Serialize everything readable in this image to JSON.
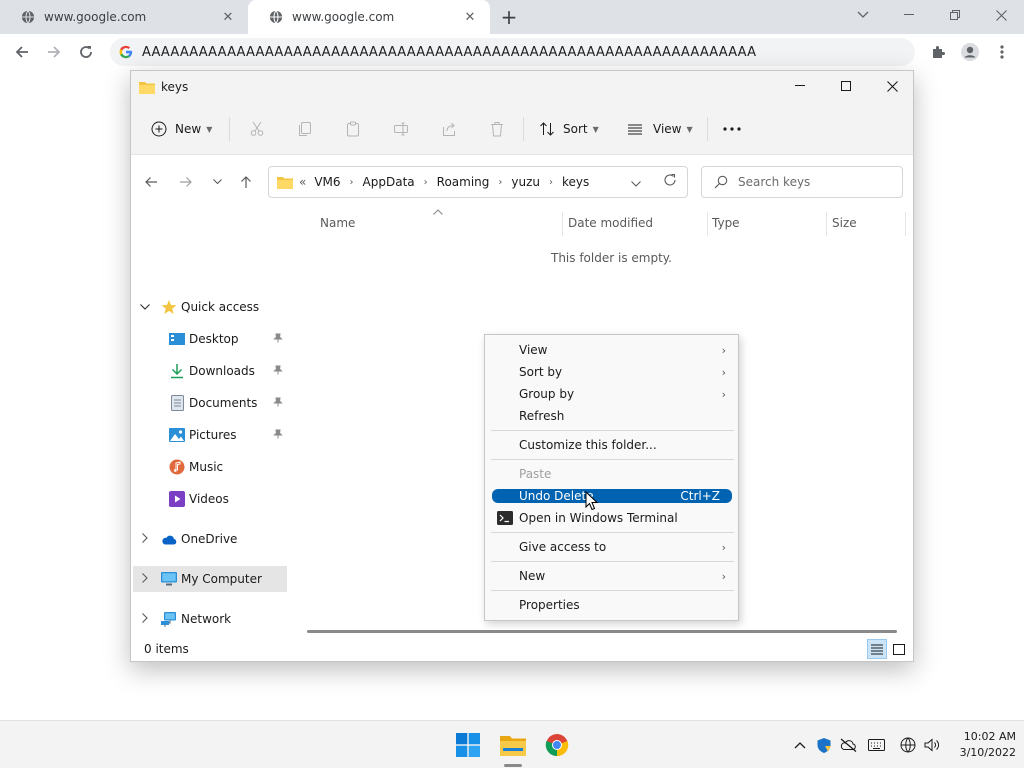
{
  "browser": {
    "tabs": [
      {
        "label": "www.google.com"
      },
      {
        "label": "www.google.com"
      }
    ],
    "url": "AAAAAAAAAAAAAAAAAAAAAAAAAAAAAAAAAAAAAAAAAAAAAAAAAAAAAAAAAAAAAAAAA"
  },
  "explorer": {
    "title": "keys",
    "commands": {
      "new_label": "New",
      "sort_label": "Sort",
      "view_label": "View"
    },
    "breadcrumb": [
      "VM6",
      "AppData",
      "Roaming",
      "yuzu",
      "keys"
    ],
    "breadcrumb_overflow": "«",
    "search_placeholder": "Search keys",
    "nav": {
      "quick_access": "Quick access",
      "desktop": "Desktop",
      "downloads": "Downloads",
      "documents": "Documents",
      "pictures": "Pictures",
      "music": "Music",
      "videos": "Videos",
      "onedrive": "OneDrive",
      "my_computer": "My Computer",
      "network": "Network"
    },
    "columns": {
      "name": "Name",
      "date_modified": "Date modified",
      "type": "Type",
      "size": "Size"
    },
    "empty_message": "This folder is empty.",
    "status": {
      "item_count": "0 items"
    }
  },
  "context_menu": {
    "view": "View",
    "sort_by": "Sort by",
    "group_by": "Group by",
    "refresh": "Refresh",
    "customize": "Customize this folder...",
    "paste": "Paste",
    "undo_delete": "Undo Delete",
    "undo_shortcut": "Ctrl+Z",
    "open_terminal": "Open in Windows Terminal",
    "give_access": "Give access to",
    "new": "New",
    "properties": "Properties"
  },
  "taskbar": {
    "time": "10:02 AM",
    "date": "3/10/2022"
  },
  "colors": {
    "accent": "#0063b1",
    "folder": "#f4c542",
    "taskbar": "#f3f3f3"
  }
}
